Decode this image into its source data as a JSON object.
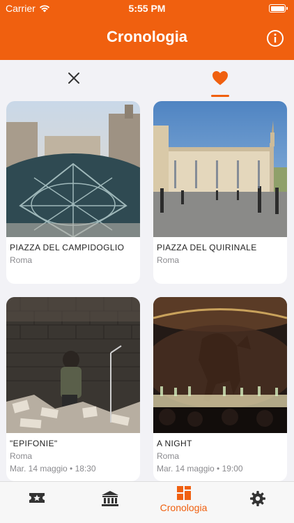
{
  "status": {
    "carrier": "Carrier",
    "time": "5:55 PM"
  },
  "header": {
    "title": "Cronologia"
  },
  "filters": {
    "close_icon": "close-icon",
    "favorite_icon": "heart-icon",
    "active": "favorites"
  },
  "cards": [
    {
      "title": "PIAZZA DEL CAMPIDOGLIO",
      "city": "Roma",
      "date": ""
    },
    {
      "title": "PIAZZA DEL QUIRINALE",
      "city": "Roma",
      "date": ""
    },
    {
      "title": "\"EPIFONIE\"",
      "city": "Roma",
      "date": "Mar. 14 maggio • 18:30"
    },
    {
      "title": "A NIGHT",
      "city": "Roma",
      "date": "Mar. 14 maggio • 19:00"
    }
  ],
  "tabbar": {
    "tabs": [
      {
        "icon": "ticket-star-icon",
        "label": ""
      },
      {
        "icon": "museum-icon",
        "label": ""
      },
      {
        "icon": "timeline-grid-icon",
        "label": "Cronologia"
      },
      {
        "icon": "gear-icon",
        "label": ""
      }
    ],
    "active_tab": "Cronologia"
  },
  "colors": {
    "accent": "#f0600f",
    "background": "#f2f2f6"
  }
}
